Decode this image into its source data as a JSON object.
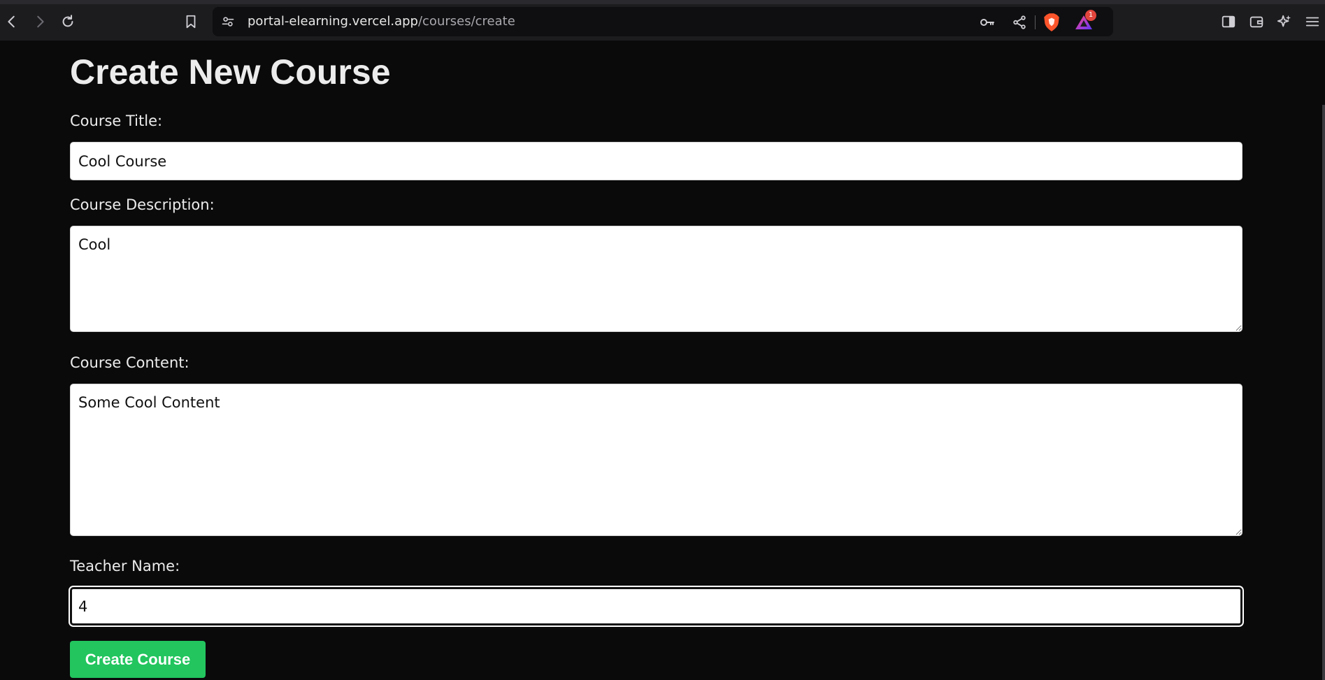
{
  "browser": {
    "url_host": "portal-elearning.vercel.app",
    "url_path": "/courses/create",
    "notification_count": "1",
    "colors": {
      "chrome_bg": "#1c1c1f",
      "url_bg": "#0f0f11",
      "badge": "#e2453c",
      "brave_orange": "#fb542b"
    }
  },
  "page": {
    "title": "Create New Course",
    "fields": {
      "title": {
        "label": "Course Title:",
        "value": "Cool Course"
      },
      "description": {
        "label": "Course Description:",
        "value": "Cool"
      },
      "content": {
        "label": "Course Content:",
        "value": "Some Cool Content"
      },
      "teacher": {
        "label": "Teacher Name:",
        "value": "4"
      }
    },
    "submit_label": "Create Course",
    "colors": {
      "background": "#0a0a0b",
      "submit": "#22c55e",
      "text": "#ececec"
    }
  },
  "icons": [
    "back-icon",
    "forward-icon",
    "reload-icon",
    "bookmark-icon",
    "site-settings-icon",
    "key-icon",
    "share-icon",
    "brave-shields-icon",
    "brave-rewards-icon",
    "sidebar-icon",
    "wallet-icon",
    "leo-ai-icon",
    "menu-icon"
  ]
}
